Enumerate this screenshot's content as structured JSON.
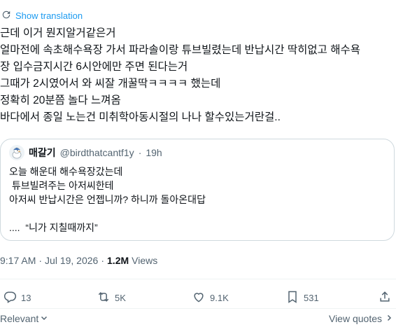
{
  "translate": {
    "label": "Show translation"
  },
  "tweet": {
    "lines": [
      "근데 이거 뭔지알거같은거",
      "얼마전에 속초해수욕장 가서 파라솔이랑 튜브빌렸는데 반납시간 딱히없고 해수욕",
      "장 입수금지시간 6시안에만 주면 된다는거",
      "그때가 2시였어서 와 씨잘 개꿀딱ㅋㅋㅋㅋ 했는데",
      "정확히 20분쯤 놀다 느껴옴",
      "바다에서 종일 노는건 미취학아동시절의 나나 할수있는거란걸.."
    ]
  },
  "quote": {
    "name": "매갈기",
    "handle": "@birdthatcantf1y",
    "dot": "·",
    "time": "19h",
    "lines": [
      "오늘 해운대 해수욕장갔는데",
      " 튜브빌려주는 아저씨한테",
      "아저씨 반납시간은 언젭니까? 하니까 돌아온대답",
      "",
      "....  “니가 지칠때까지”"
    ]
  },
  "meta": {
    "time": "9:17 AM",
    "dot": "·",
    "date": "Jul 19, 2026",
    "dot2": "·",
    "views_count": "1.2M",
    "views_label": "Views"
  },
  "actions": {
    "replies": "13",
    "reposts": "5K",
    "likes": "9.1K",
    "bookmarks": "531"
  },
  "bottom": {
    "sort_label": "Relevant",
    "view_quotes": "View quotes"
  }
}
